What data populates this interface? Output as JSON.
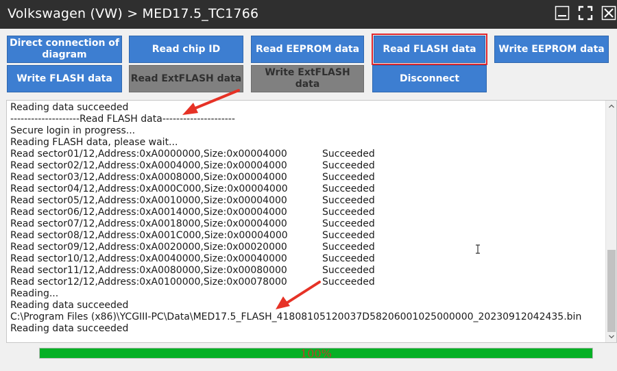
{
  "window": {
    "title": "Volkswagen (VW) > MED17.5_TC1766"
  },
  "buttons": {
    "direct_connection": "Direct connection of diagram",
    "read_chip_id": "Read chip ID",
    "read_eeprom": "Read EEPROM data",
    "read_flash": "Read FLASH data",
    "write_eeprom": "Write EEPROM data",
    "write_flash": "Write FLASH data",
    "read_extflash": "Read ExtFLASH data",
    "write_extflash": "Write ExtFLASH data",
    "disconnect": "Disconnect"
  },
  "log": {
    "lines": [
      {
        "text": "Reading data succeeded",
        "status": ""
      },
      {
        "text": "--------------------Read FLASH data---------------------",
        "status": ""
      },
      {
        "text": "Secure login in progress...",
        "status": ""
      },
      {
        "text": "Reading FLASH data, please wait...",
        "status": ""
      },
      {
        "text": "Read sector01/12,Address:0xA0000000,Size:0x00004000",
        "status": "Succeeded"
      },
      {
        "text": "Read sector02/12,Address:0xA0004000,Size:0x00004000",
        "status": "Succeeded"
      },
      {
        "text": "Read sector03/12,Address:0xA0008000,Size:0x00004000",
        "status": "Succeeded"
      },
      {
        "text": "Read sector04/12,Address:0xA000C000,Size:0x00004000",
        "status": "Succeeded"
      },
      {
        "text": "Read sector05/12,Address:0xA0010000,Size:0x00004000",
        "status": "Succeeded"
      },
      {
        "text": "Read sector06/12,Address:0xA0014000,Size:0x00004000",
        "status": "Succeeded"
      },
      {
        "text": "Read sector07/12,Address:0xA0018000,Size:0x00004000",
        "status": "Succeeded"
      },
      {
        "text": "Read sector08/12,Address:0xA001C000,Size:0x00004000",
        "status": "Succeeded"
      },
      {
        "text": "Read sector09/12,Address:0xA0020000,Size:0x00020000",
        "status": "Succeeded"
      },
      {
        "text": "Read sector10/12,Address:0xA0040000,Size:0x00040000",
        "status": "Succeeded"
      },
      {
        "text": "Read sector11/12,Address:0xA0080000,Size:0x00080000",
        "status": "Succeeded"
      },
      {
        "text": "Read sector12/12,Address:0xA0100000,Size:0x00078000",
        "status": "Succeeded"
      },
      {
        "text": "Reading...",
        "status": ""
      },
      {
        "text": "Reading data succeeded",
        "status": ""
      },
      {
        "text": "C:\\Program Files (x86)\\YCGIII-PC\\Data\\MED17.5_FLASH_41808105120037D58206001025000000_20230912042435.bin",
        "status": ""
      },
      {
        "text": "Reading data succeeded",
        "status": ""
      }
    ]
  },
  "progress": {
    "value": 1.0,
    "label": "100%"
  },
  "colors": {
    "button_blue": "#3d7ed1",
    "button_disabled": "#808080",
    "highlight_red": "#e0262c",
    "progress_green": "#06b025",
    "title_bar": "#2f2f2f"
  },
  "icons": {
    "minimize": "minimize-icon",
    "maximize": "maximize-icon",
    "close": "close-icon"
  }
}
